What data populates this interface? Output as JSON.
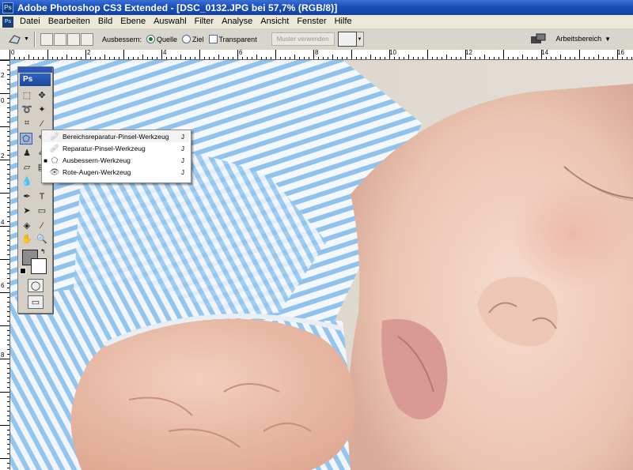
{
  "window": {
    "title": "Adobe Photoshop CS3 Extended - [DSC_0132.JPG bei 57,7% (RGB/8)]",
    "app_icon": "Ps"
  },
  "menu": {
    "logo": "Ps",
    "items": [
      "Datei",
      "Bearbeiten",
      "Bild",
      "Ebene",
      "Auswahl",
      "Filter",
      "Analyse",
      "Ansicht",
      "Fenster",
      "Hilfe"
    ]
  },
  "options": {
    "tool_label": "Ausbessern:",
    "radio_source": "Quelle",
    "radio_target": "Ziel",
    "transparent_label": "Transparent",
    "use_pattern_label": "Muster verwenden",
    "workspace_label": "Arbeitsbereich"
  },
  "rulers": {
    "top": [
      "0",
      "2",
      "4",
      "6",
      "8",
      "10",
      "12",
      "14",
      "16"
    ],
    "left": [
      "2",
      "0",
      "2",
      "4",
      "6",
      "8"
    ]
  },
  "toolbox": {
    "logo": "Ps"
  },
  "flyout": {
    "items": [
      {
        "label": "Bereichsreparatur-Pinsel-Werkzeug",
        "key": "J",
        "selected": false,
        "icon": "spot-healing-brush-icon"
      },
      {
        "label": "Reparatur-Pinsel-Werkzeug",
        "key": "J",
        "selected": false,
        "icon": "healing-brush-icon"
      },
      {
        "label": "Ausbessern-Werkzeug",
        "key": "J",
        "selected": true,
        "icon": "patch-tool-icon"
      },
      {
        "label": "Rote-Augen-Werkzeug",
        "key": "J",
        "selected": false,
        "icon": "red-eye-tool-icon"
      }
    ],
    "selected_bullet": "■"
  },
  "colors": {
    "title_bar": "#1a50b8",
    "highlight": "#9db5e0",
    "stripe_blue": "#8fc3ee"
  }
}
